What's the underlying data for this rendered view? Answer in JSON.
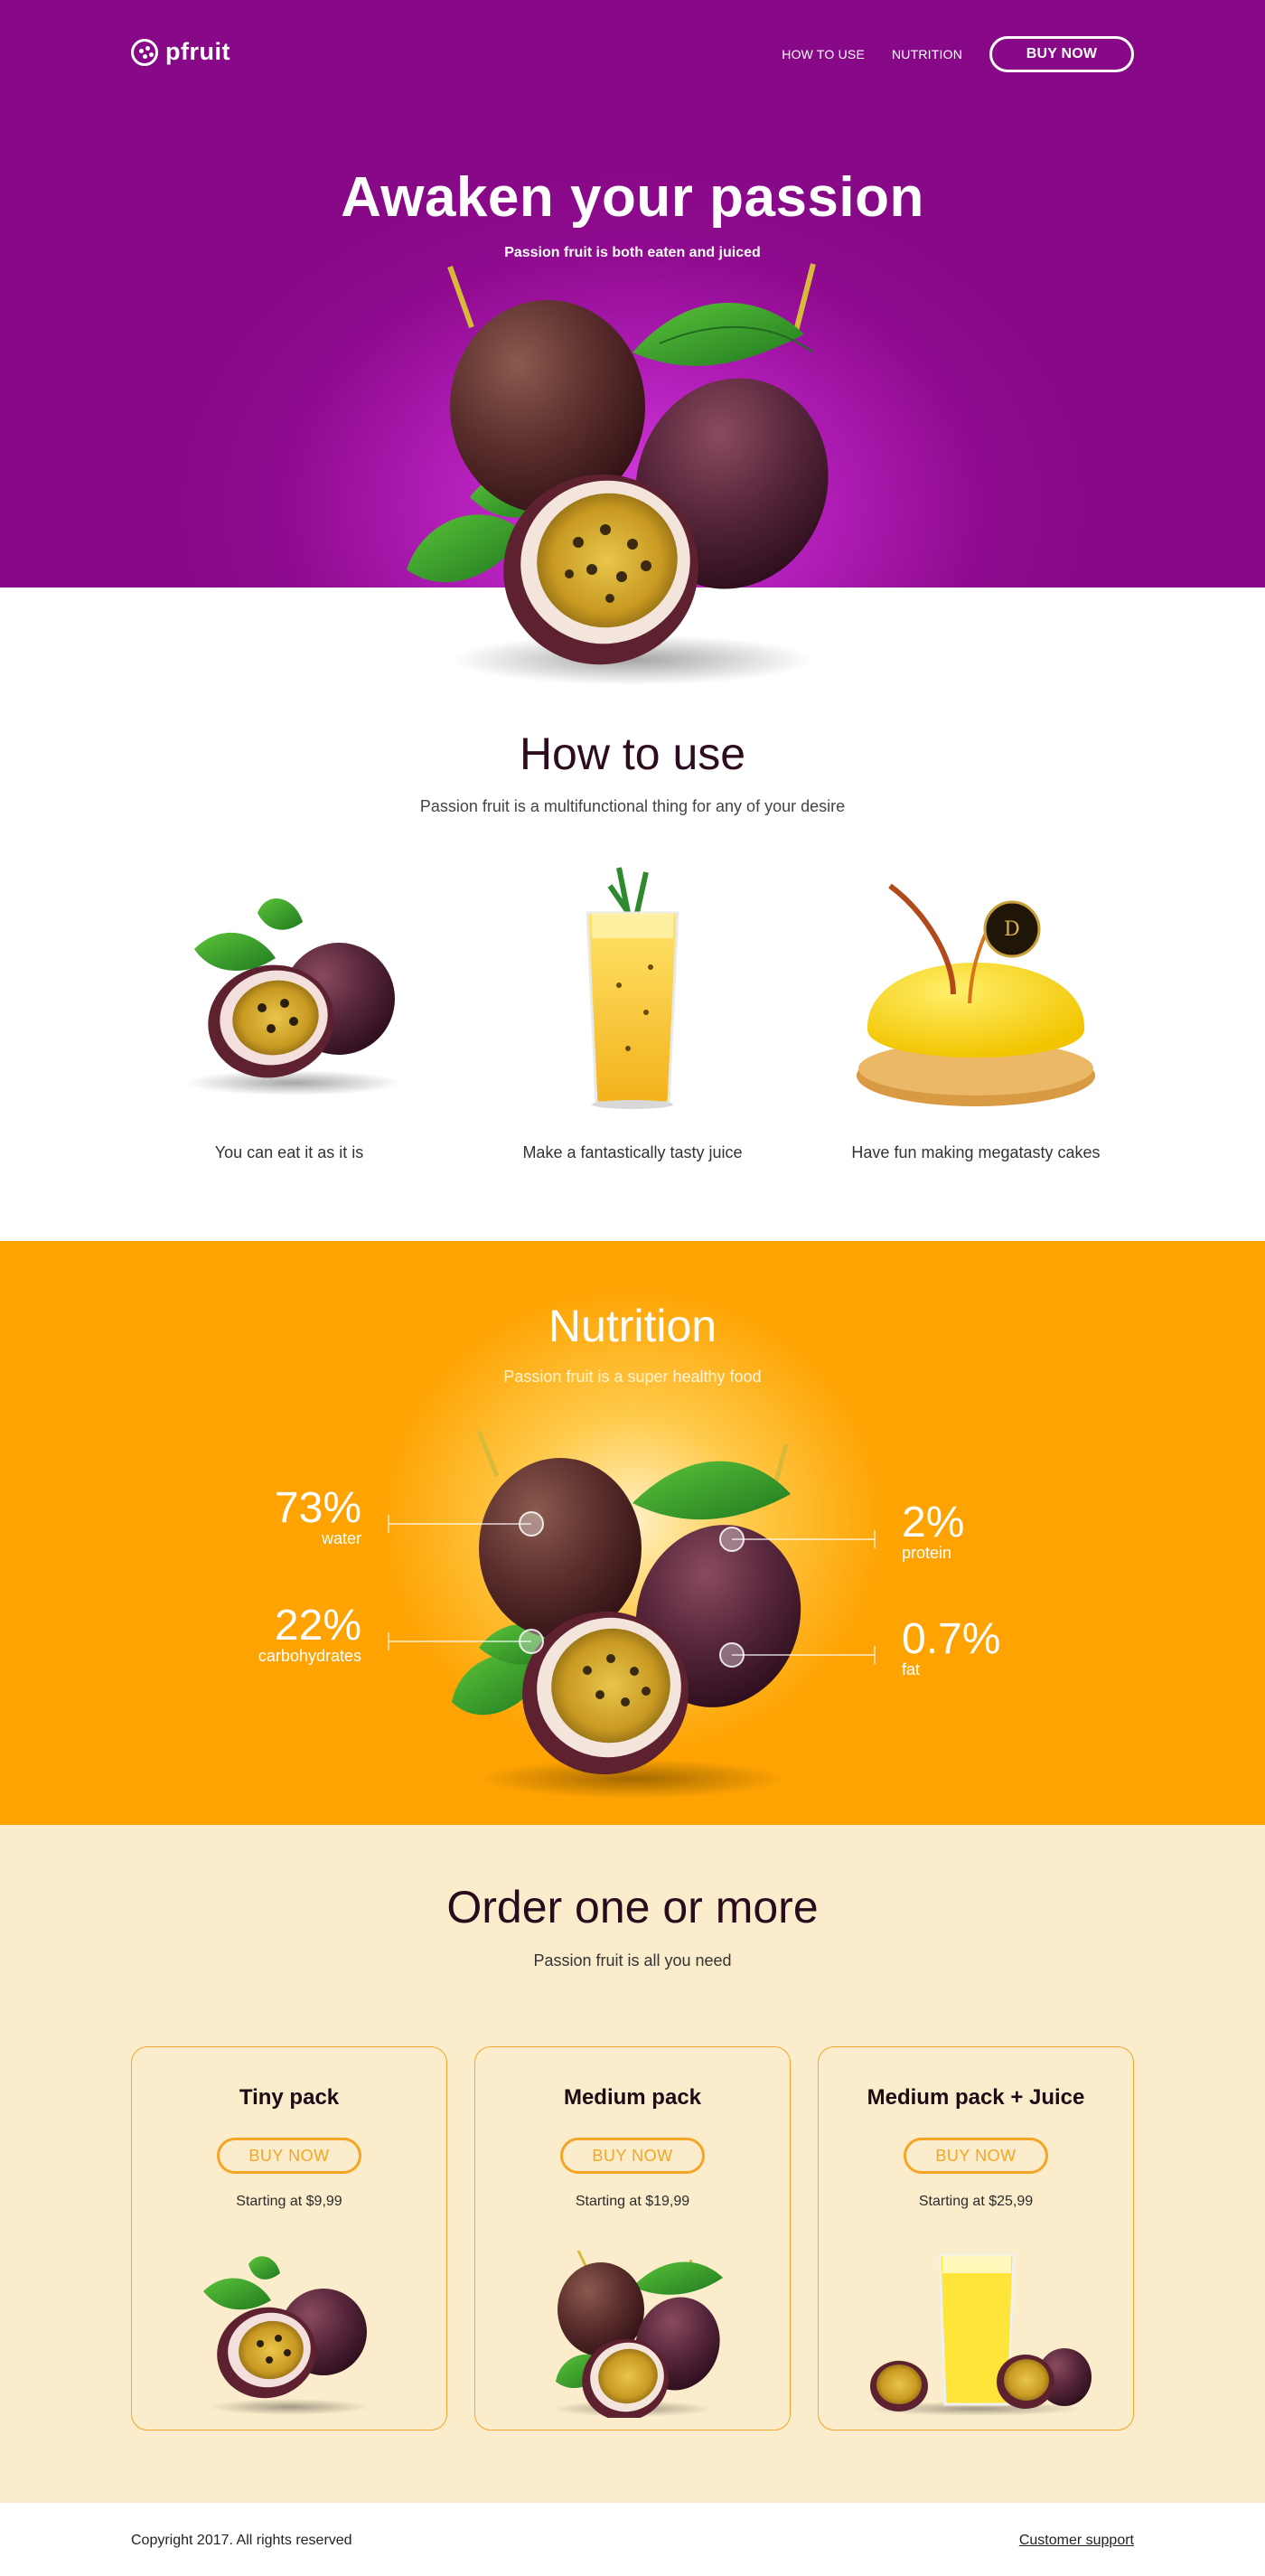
{
  "header": {
    "logo_text": "pfruit",
    "nav": [
      {
        "label": "HOW TO USE"
      },
      {
        "label": "NUTRITION"
      }
    ],
    "buy_label": "BUY NOW"
  },
  "hero": {
    "title": "Awaken your passion",
    "subtitle": "Passion fruit is both eaten and juiced"
  },
  "how_to_use": {
    "title": "How to use",
    "subtitle": "Passion fruit is a multifunctional thing for any of your desire",
    "items": [
      {
        "caption": "You can eat it as it is",
        "icon": "passion-fruit-halves"
      },
      {
        "caption": "Make a fantastically tasty juice",
        "icon": "juice-glass"
      },
      {
        "caption": "Have fun making megatasty cakes",
        "icon": "yellow-cake"
      }
    ]
  },
  "nutrition": {
    "title": "Nutrition",
    "subtitle": "Passion fruit is a super healthy food",
    "stats": [
      {
        "value": "73%",
        "label": "water"
      },
      {
        "value": "22%",
        "label": "carbohydrates"
      },
      {
        "value": "2%",
        "label": "protein"
      },
      {
        "value": "0.7%",
        "label": "fat"
      }
    ]
  },
  "order": {
    "title": "Order one or more",
    "subtitle": "Passion fruit is all you need",
    "packs": [
      {
        "name": "Tiny pack",
        "button": "BUY NOW",
        "price": "Starting at $9,99"
      },
      {
        "name": "Medium pack",
        "button": "BUY NOW",
        "price": "Starting at $19,99"
      },
      {
        "name": "Medium pack + Juice",
        "button": "BUY NOW",
        "price": "Starting at $25,99"
      }
    ]
  },
  "footer": {
    "copyright": "Copyright 2017. All rights reserved",
    "support": "Customer support"
  },
  "colors": {
    "hero_purple": "#8f0a8f",
    "nutrition_orange": "#fea302",
    "order_cream": "#fbedcc",
    "accent_orange": "#f4a526"
  }
}
